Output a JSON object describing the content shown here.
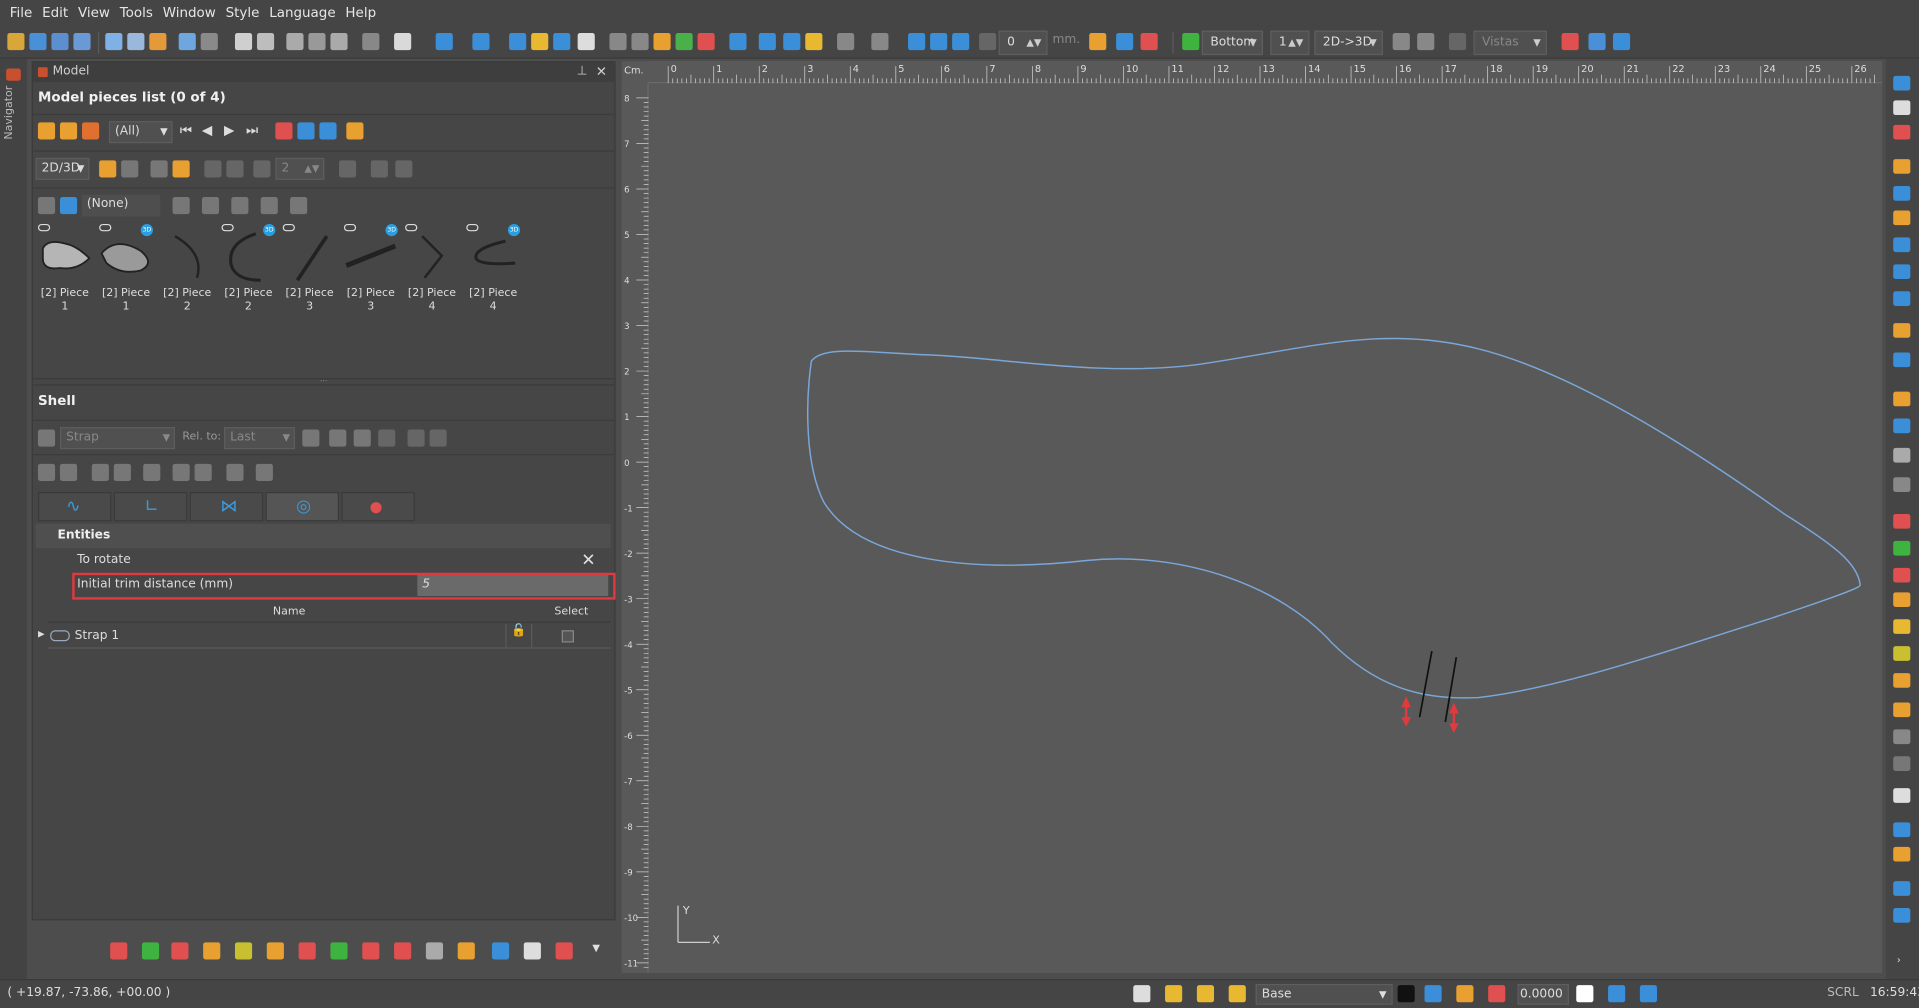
{
  "menu": [
    "File",
    "Edit",
    "View",
    "Tools",
    "Window",
    "Style",
    "Language",
    "Help"
  ],
  "toolbar": {
    "value_field": "0",
    "unit": "mm.",
    "side_combo": "Bottom",
    "count_field": "1",
    "mode_combo": "2D->3D",
    "views_combo": "Vistas"
  },
  "navigator_label": "Navigator",
  "model_panel": {
    "title": "Model",
    "list_title": "Model pieces list (0 of 4)",
    "filter_combo": "(All)",
    "view_combo": "2D/3D",
    "number_field": "2",
    "selection_combo": "(None)",
    "pieces": [
      {
        "label_line1": "[2] Piece",
        "label_line2": "1",
        "badge": "3D"
      },
      {
        "label_line1": "[2] Piece",
        "label_line2": "1",
        "badge": "3D"
      },
      {
        "label_line1": "[2] Piece",
        "label_line2": "2",
        "badge": ""
      },
      {
        "label_line1": "[2] Piece",
        "label_line2": "2",
        "badge": "3D"
      },
      {
        "label_line1": "[2] Piece",
        "label_line2": "3",
        "badge": ""
      },
      {
        "label_line1": "[2] Piece",
        "label_line2": "3",
        "badge": "3D"
      },
      {
        "label_line1": "[2] Piece",
        "label_line2": "4",
        "badge": ""
      },
      {
        "label_line1": "[2] Piece",
        "label_line2": "4",
        "badge": "3D"
      }
    ]
  },
  "shell_panel": {
    "title": "Shell",
    "strap_combo": "Strap",
    "rel_to_label": "Rel. to:",
    "rel_to_combo": "Last",
    "entities_header": "Entities",
    "to_rotate_label": "To rotate",
    "trim_label": "Initial trim distance (mm)",
    "trim_value": "5",
    "table_headers": {
      "name": "Name",
      "select": "Select"
    },
    "rows": [
      {
        "name": "Strap 1"
      }
    ]
  },
  "canvas": {
    "ruler_unit": "Cm.",
    "x_ticks": [
      "0",
      "1",
      "2",
      "3",
      "4",
      "5",
      "6",
      "7",
      "8",
      "9",
      "10",
      "11",
      "12",
      "13",
      "14",
      "15",
      "16",
      "17",
      "18",
      "19",
      "20",
      "21",
      "22",
      "23",
      "24",
      "25",
      "26"
    ],
    "y_ticks": [
      "8",
      "7",
      "6",
      "5",
      "4",
      "3",
      "2",
      "1",
      "0",
      "-1",
      "-2",
      "-3",
      "-4",
      "-5",
      "-6",
      "-7",
      "-8",
      "-9",
      "-10",
      "-11"
    ],
    "axis_x": "X",
    "axis_y": "Y",
    "outline_color": "#7aa7d8"
  },
  "status": {
    "coords": "( +19.87, -73.86, +00.00 )",
    "layer_combo": "Base",
    "value": "0.0000",
    "scrl": "SCRL",
    "time": "16:59:43"
  }
}
